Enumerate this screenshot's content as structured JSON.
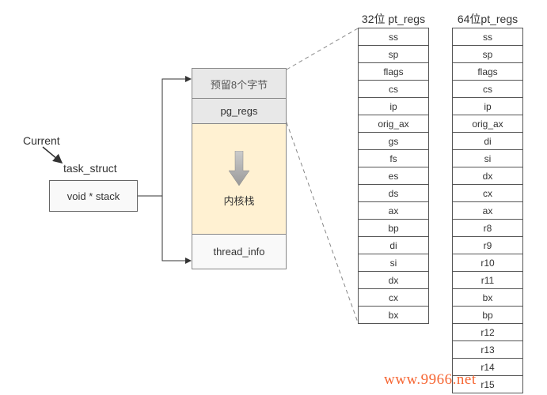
{
  "labels": {
    "current": "Current",
    "task_struct": "task_struct",
    "void_stack": "void * stack"
  },
  "mid": {
    "header": "预留8个字节",
    "pgregs": "pg_regs",
    "kernel": "内核栈",
    "thread": "thread_info"
  },
  "headers": {
    "c32": "32位 pt_regs",
    "c64": "64位pt_regs"
  },
  "regs32": [
    "ss",
    "sp",
    "flags",
    "cs",
    "ip",
    "orig_ax",
    "gs",
    "fs",
    "es",
    "ds",
    "ax",
    "bp",
    "di",
    "si",
    "dx",
    "cx",
    "bx"
  ],
  "regs64": [
    "ss",
    "sp",
    "flags",
    "cs",
    "ip",
    "orig_ax",
    "di",
    "si",
    "dx",
    "cx",
    "ax",
    "r8",
    "r9",
    "r10",
    "r11",
    "bx",
    "bp",
    "r12",
    "r13",
    "r14",
    "r15"
  ],
  "watermark": "www.9966.net"
}
